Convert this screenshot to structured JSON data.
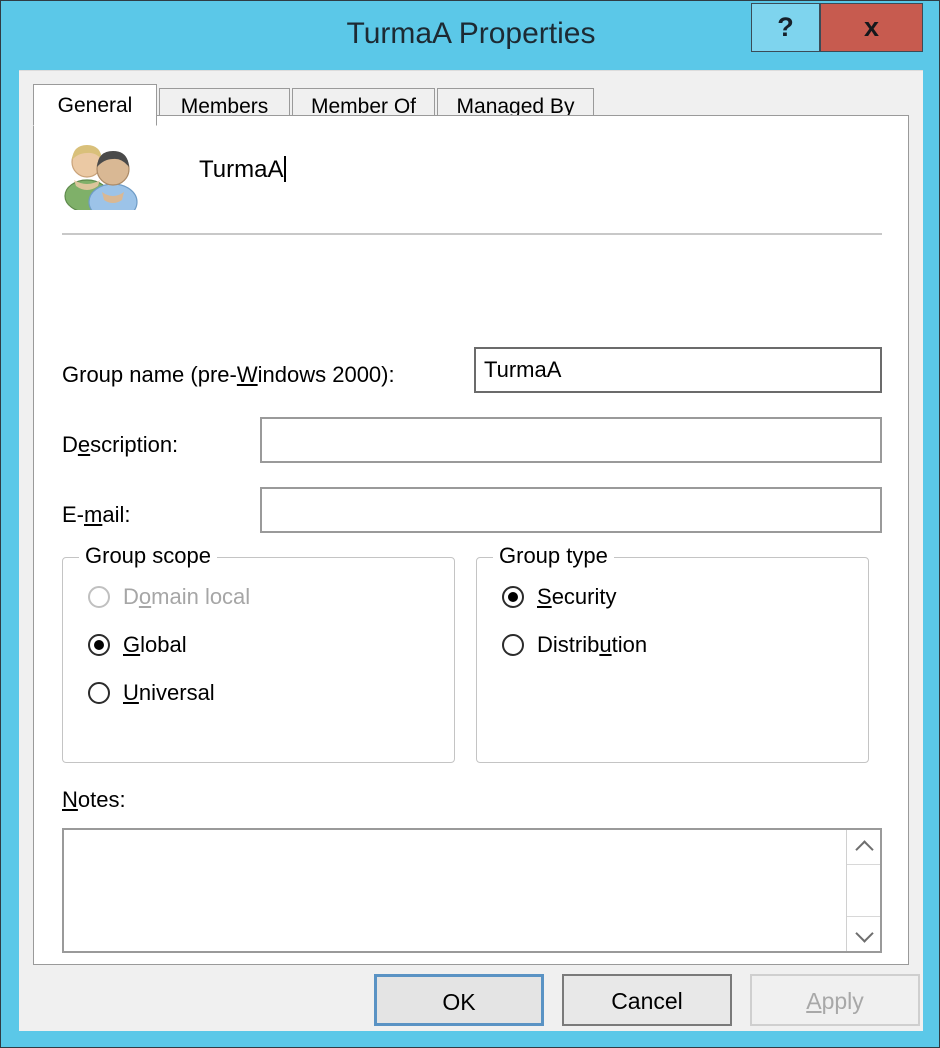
{
  "window": {
    "title": "TurmaA Properties",
    "help_label": "?",
    "close_label": "x",
    "border_color": "#5BC8E8",
    "close_button_color": "#C75B4F"
  },
  "tabs": [
    {
      "label": "General",
      "active": true
    },
    {
      "label": "Members",
      "active": false
    },
    {
      "label": "Member Of",
      "active": false
    },
    {
      "label": "Managed By",
      "active": false
    }
  ],
  "general": {
    "icon_name": "group-users-icon",
    "display_name": "TurmaA",
    "fields": {
      "group_name_label_pre": "Group name (pre-",
      "group_name_label_accel": "W",
      "group_name_label_post": "indows 2000):",
      "group_name_value": "TurmaA",
      "description_label_pre": "D",
      "description_label_accel": "e",
      "description_label_post": "scription:",
      "description_value": "",
      "email_label_pre": "E-",
      "email_label_accel": "m",
      "email_label_post": "ail:",
      "email_value": ""
    },
    "group_scope": {
      "title": "Group scope",
      "options": [
        {
          "pre": "D",
          "accel": "o",
          "post": "main local",
          "checked": false,
          "disabled": true
        },
        {
          "pre": "",
          "accel": "G",
          "post": "lobal",
          "checked": true,
          "disabled": false
        },
        {
          "pre": "",
          "accel": "U",
          "post": "niversal",
          "checked": false,
          "disabled": false
        }
      ]
    },
    "group_type": {
      "title": "Group type",
      "options": [
        {
          "pre": "",
          "accel": "S",
          "post": "ecurity",
          "checked": true,
          "disabled": false
        },
        {
          "pre": "Distrib",
          "accel": "u",
          "post": "tion",
          "checked": false,
          "disabled": false
        }
      ]
    },
    "notes": {
      "label_pre": "",
      "label_accel": "N",
      "label_post": "otes:",
      "value": "",
      "scroll_up_icon": "chevron-up-icon",
      "scroll_down_icon": "chevron-down-icon"
    }
  },
  "buttons": {
    "ok": "OK",
    "cancel": "Cancel",
    "apply_pre": "",
    "apply_accel": "A",
    "apply_post": "pply",
    "apply_disabled": true
  }
}
